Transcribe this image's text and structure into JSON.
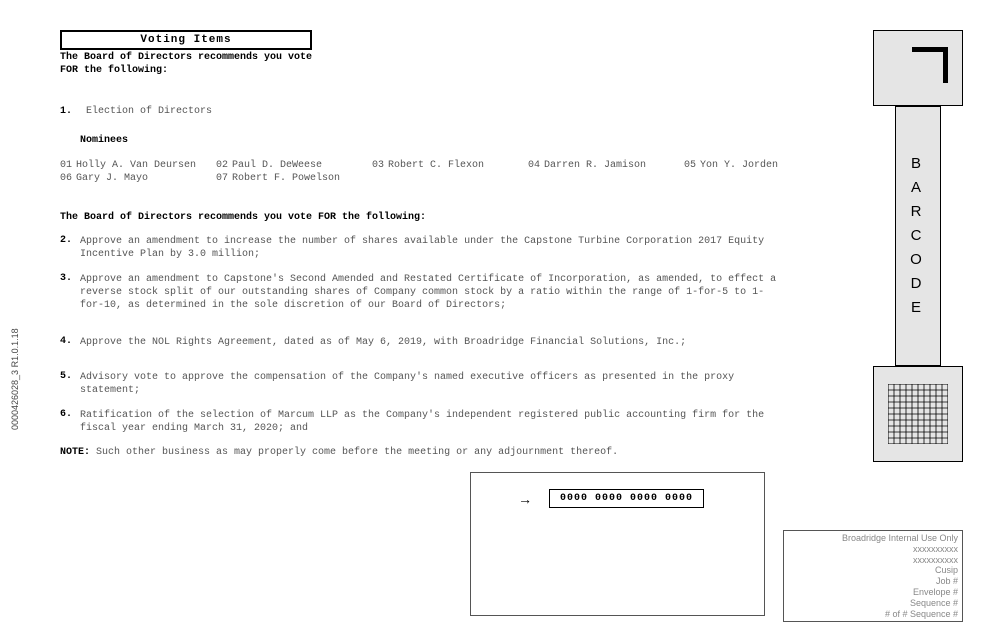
{
  "title": "Voting Items",
  "recommend1a": "The Board of Directors recommends you vote",
  "recommend1b": "FOR the following:",
  "item1": {
    "num": "1.",
    "text": "Election of Directors"
  },
  "nominees_label": "Nominees",
  "nominees": [
    {
      "n": "01",
      "name": "Holly A. Van Deursen"
    },
    {
      "n": "02",
      "name": "Paul D. DeWeese"
    },
    {
      "n": "03",
      "name": "Robert C. Flexon"
    },
    {
      "n": "04",
      "name": "Darren R. Jamison"
    },
    {
      "n": "05",
      "name": "Yon Y. Jorden"
    },
    {
      "n": "06",
      "name": "Gary J. Mayo"
    },
    {
      "n": "07",
      "name": "Robert F. Powelson"
    }
  ],
  "recommend2": "The Board of Directors recommends you vote FOR the following:",
  "proposals": [
    {
      "n": "2.",
      "t": "Approve an amendment to increase the number of shares available under the Capstone Turbine Corporation 2017 Equity Incentive Plan by 3.0 million;"
    },
    {
      "n": "3.",
      "t": "Approve an amendment to Capstone's Second Amended and Restated Certificate of Incorporation, as amended, to effect a reverse stock split of our outstanding shares of Company common stock by a ratio within the range of 1-for-5 to 1-for-10, as determined in the sole discretion of our Board of Directors;"
    },
    {
      "n": "4.",
      "t": "Approve the NOL Rights Agreement, dated as of May 6, 2019, with Broadridge Financial Solutions, Inc.;"
    },
    {
      "n": "5.",
      "t": "Advisory vote to approve the compensation of the Company's named executive officers as presented in the proxy statement;"
    },
    {
      "n": "6.",
      "t": "Ratification of the selection of Marcum LLP as the Company's independent registered public accounting firm for the fiscal year ending March 31, 2020; and"
    }
  ],
  "note_label": "NOTE:",
  "note_text": " Such other business as may properly come before the meeting or any adjournment thereof.",
  "zeros": "0000 0000 0000 0000",
  "barcode_label": "BARCODE",
  "internal": {
    "hdr": "Broadridge Internal Use Only",
    "l1": "xxxxxxxxxx",
    "l2": "xxxxxxxxxx",
    "l3": "Cusip",
    "l4": "Job #",
    "l5": "Envelope #",
    "l6": "Sequence #",
    "l7": "# of # Sequence #"
  },
  "left_label": "0000426028_3    R1.0.1.18"
}
